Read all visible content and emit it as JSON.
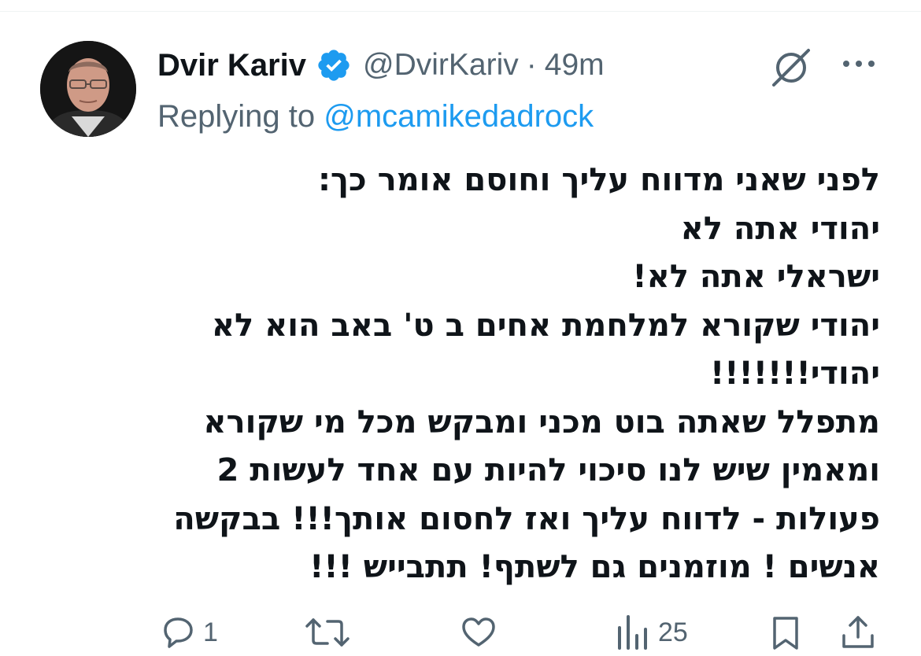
{
  "tweet": {
    "author_name": "Dvir Kariv",
    "handle": "@DvirKariv",
    "separator": "·",
    "time": "49m",
    "reply_prefix": "Replying to",
    "reply_to": "@mcamikedadrock",
    "text_lines": [
      "לפני שאני מדווח עליך וחוסם אומר כך:",
      "יהודי אתה לא",
      "ישראלי אתה לא!",
      "יהודי שקורא למלחמת אחים ב ט' באב הוא לא",
      "יהודי!!!!!!!",
      "מתפלל שאתה בוט מכני ומבקש מכל מי שקורא",
      "ומאמין שיש לנו סיכוי להיות עם אחד לעשות 2",
      "פעולות - לדווח עליך ואז לחסום אותך!!! בבקשה",
      "אנשים ! מוזמנים גם לשתף! תתבייש !!!"
    ]
  },
  "icons": {
    "verified": "verified-badge-icon",
    "grok": "grok-icon",
    "more": "more-icon",
    "reply": "reply-icon",
    "retweet": "retweet-icon",
    "like": "heart-icon",
    "views": "views-icon",
    "bookmark": "bookmark-icon",
    "share": "share-icon"
  },
  "actions": {
    "reply_count": "1",
    "views_count": "25"
  },
  "colors": {
    "verified": "#1d9bf0",
    "link": "#1d9bf0",
    "secondary_text": "#536471",
    "primary_text": "#0f1419"
  }
}
